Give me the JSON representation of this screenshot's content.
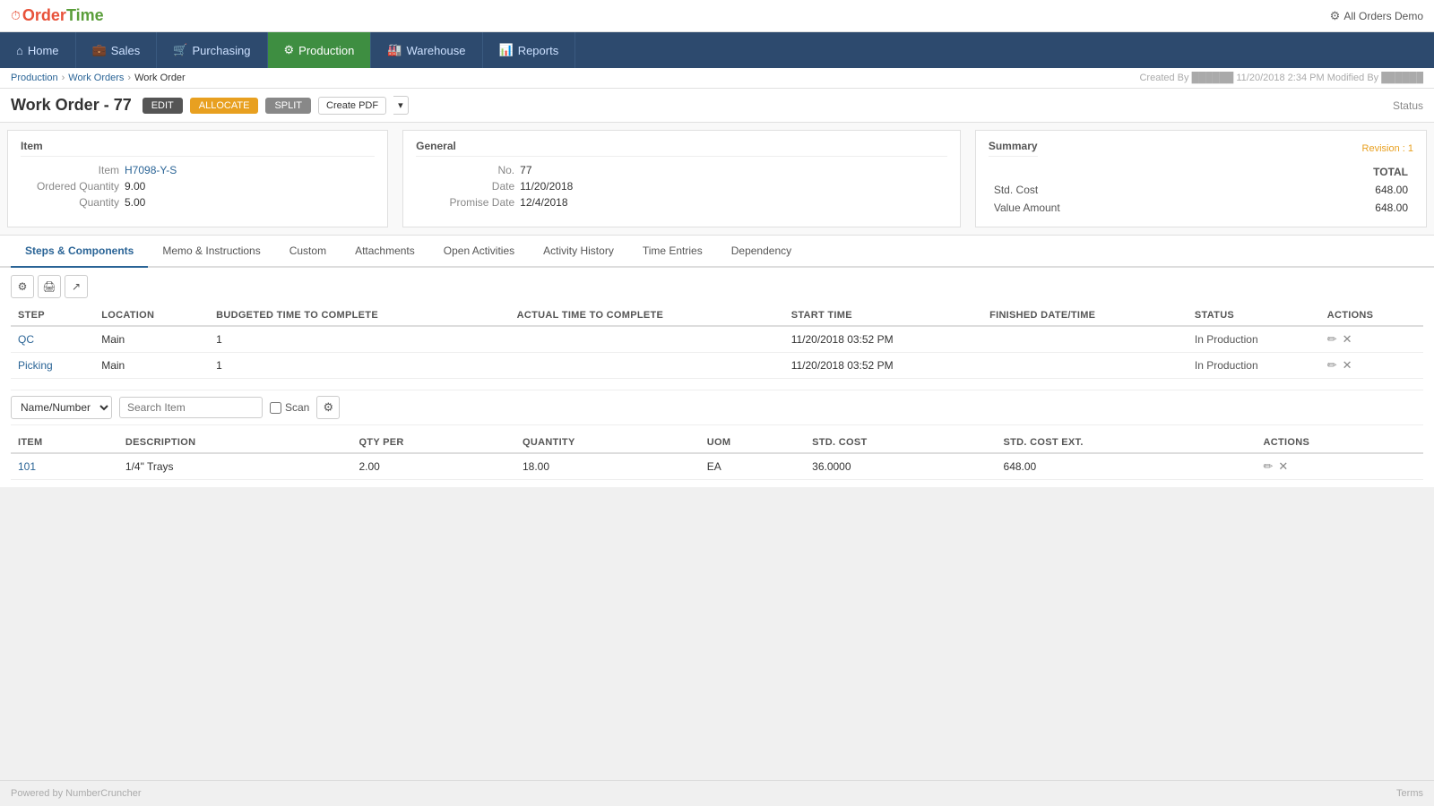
{
  "app": {
    "logo_order": "Order",
    "logo_time": "Time",
    "top_right_label": "All Orders Demo",
    "footer_left": "Powered by NumberCruncher",
    "footer_right": "Terms"
  },
  "nav": {
    "items": [
      {
        "id": "home",
        "label": "Home",
        "icon": "⌂",
        "active": false
      },
      {
        "id": "sales",
        "label": "Sales",
        "icon": "💼",
        "active": false
      },
      {
        "id": "purchasing",
        "label": "Purchasing",
        "icon": "🛒",
        "active": false
      },
      {
        "id": "production",
        "label": "Production",
        "icon": "⚙",
        "active": true
      },
      {
        "id": "warehouse",
        "label": "Warehouse",
        "icon": "🏭",
        "active": false
      },
      {
        "id": "reports",
        "label": "Reports",
        "icon": "📊",
        "active": false
      }
    ]
  },
  "breadcrumb": {
    "items": [
      "Production",
      "Work Orders",
      "Work Order"
    ],
    "created_info": "Created By ██████ 11/20/2018 2:34 PM   Modified By ██████"
  },
  "work_order": {
    "title": "Work Order - 77",
    "btn_edit": "EDIT",
    "btn_allocate": "ALLOCATE",
    "btn_split": "SPLIT",
    "btn_pdf": "Create PDF",
    "status_label": "Status"
  },
  "panel_item": {
    "title": "Item",
    "item_label": "Item",
    "item_value": "H7098-Y-S",
    "ordered_qty_label": "Ordered Quantity",
    "ordered_qty_value": "9.00",
    "qty_label": "Quantity",
    "qty_value": "5.00"
  },
  "panel_general": {
    "title": "General",
    "no_label": "No.",
    "no_value": "77",
    "date_label": "Date",
    "date_value": "11/20/2018",
    "promise_date_label": "Promise Date",
    "promise_date_value": "12/4/2018"
  },
  "panel_summary": {
    "title": "Summary",
    "revision_label": "Revision : 1",
    "total_header": "TOTAL",
    "std_cost_label": "Std. Cost",
    "std_cost_value": "648.00",
    "value_amount_label": "Value Amount",
    "value_amount_value": "648.00"
  },
  "tabs": [
    {
      "id": "steps-components",
      "label": "Steps & Components",
      "active": true
    },
    {
      "id": "memo-instructions",
      "label": "Memo & Instructions",
      "active": false
    },
    {
      "id": "custom",
      "label": "Custom",
      "active": false
    },
    {
      "id": "attachments",
      "label": "Attachments",
      "active": false
    },
    {
      "id": "open-activities",
      "label": "Open Activities",
      "active": false
    },
    {
      "id": "activity-history",
      "label": "Activity History",
      "active": false
    },
    {
      "id": "time-entries",
      "label": "Time Entries",
      "active": false
    },
    {
      "id": "dependency",
      "label": "Dependency",
      "active": false
    }
  ],
  "steps_table": {
    "columns": [
      "STEP",
      "LOCATION",
      "BUDGETED TIME TO COMPLETE",
      "ACTUAL TIME TO COMPLETE",
      "START TIME",
      "FINISHED DATE/TIME",
      "STATUS",
      "ACTIONS"
    ],
    "rows": [
      {
        "step": "QC",
        "location": "Main",
        "budgeted": "1",
        "actual": "",
        "start_time": "11/20/2018 03:52 PM",
        "finished": "",
        "status": "In Production"
      },
      {
        "step": "Picking",
        "location": "Main",
        "budgeted": "1",
        "actual": "",
        "start_time": "11/20/2018 03:52 PM",
        "finished": "",
        "status": "In Production"
      }
    ]
  },
  "filter_bar": {
    "select_options": [
      "Name/Number"
    ],
    "selected": "Name/Number",
    "search_placeholder": "Search Item",
    "scan_label": "Scan"
  },
  "components_table": {
    "columns": [
      "ITEM",
      "DESCRIPTION",
      "QTY PER",
      "QUANTITY",
      "UOM",
      "STD. COST",
      "STD. COST EXT.",
      "ACTIONS"
    ],
    "rows": [
      {
        "item": "101",
        "description": "1/4\" Trays",
        "qty_per": "2.00",
        "quantity": "18.00",
        "uom": "EA",
        "std_cost": "36.0000",
        "std_cost_ext": "648.00"
      }
    ]
  }
}
